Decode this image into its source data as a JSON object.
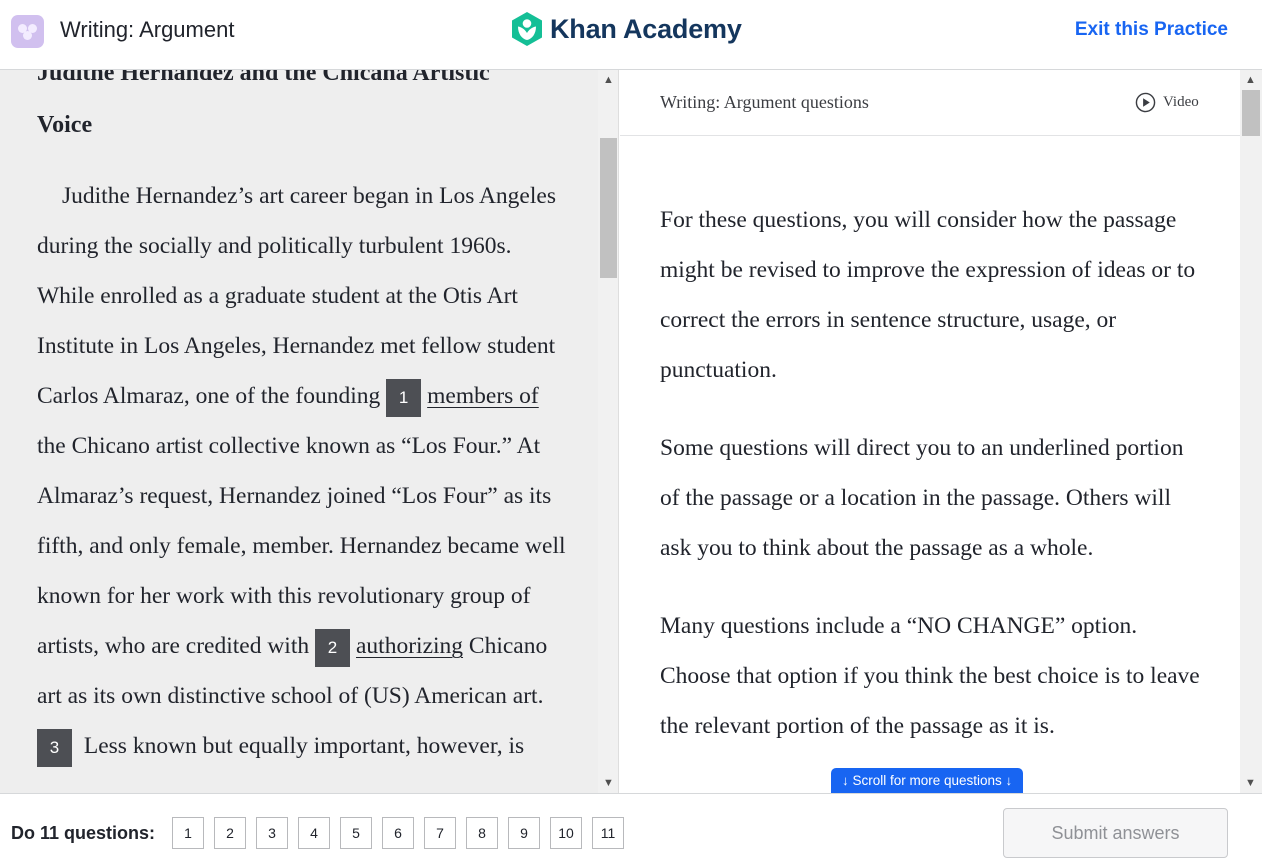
{
  "header": {
    "title": "Writing: Argument",
    "logo_text": "Khan Academy",
    "exit_label": "Exit this Practice"
  },
  "passage": {
    "title_line1": "Judithe Hernandez and the Chicana Artistic",
    "title_line2": "Voice",
    "q1_number": "1",
    "q1_underlined": "members of",
    "q2_number": "2",
    "q2_underlined": "authorizing",
    "q3_number": "3",
    "text_a": "Judithe Hernandez’s art career began in Los Angeles during the socially and politically turbulent 1960s. While enrolled as a graduate student at the Otis Art Institute in Los Angeles, Hernandez met fellow student Carlos Almaraz, one of the founding ",
    "text_b": " the Chicano artist collective known as “Los Four.” At Almaraz’s request, Hernandez joined “Los Four” as its fifth, and only female, member. Hernandez became well known for her work with this revolutionary group of artists, who are credited with ",
    "text_c": " Chicano art as its own distinctive school of (US) American art.",
    "text_d": " Less known but equally important, however, is"
  },
  "questions_panel": {
    "title": "Writing: Argument questions",
    "video_label": "Video",
    "paragraphs": [
      "For these questions, you will consider how the passage might be revised to improve the expression of ideas or to correct the errors in sentence structure, usage, or punctuation.",
      "Some questions will direct you to an underlined portion of the passage or a location in the passage. Others will ask you to think about the passage as a whole.",
      "Many questions include a “NO CHANGE” option. Choose that option if you think the best choice is to leave the relevant portion of the passage as it is."
    ],
    "scroll_hint": "↓ Scroll for more questions ↓"
  },
  "footer": {
    "label_prefix": "Do 11 questions:",
    "question_numbers": [
      "1",
      "2",
      "3",
      "4",
      "5",
      "6",
      "7",
      "8",
      "9",
      "10",
      "11"
    ],
    "submit_label": "Submit answers"
  },
  "colors": {
    "accent": "#1865f2",
    "brand_green": "#14bf96",
    "brand_navy": "#14365d",
    "question_marker": "#4d4f54",
    "passage_bg": "#eeeeee"
  }
}
